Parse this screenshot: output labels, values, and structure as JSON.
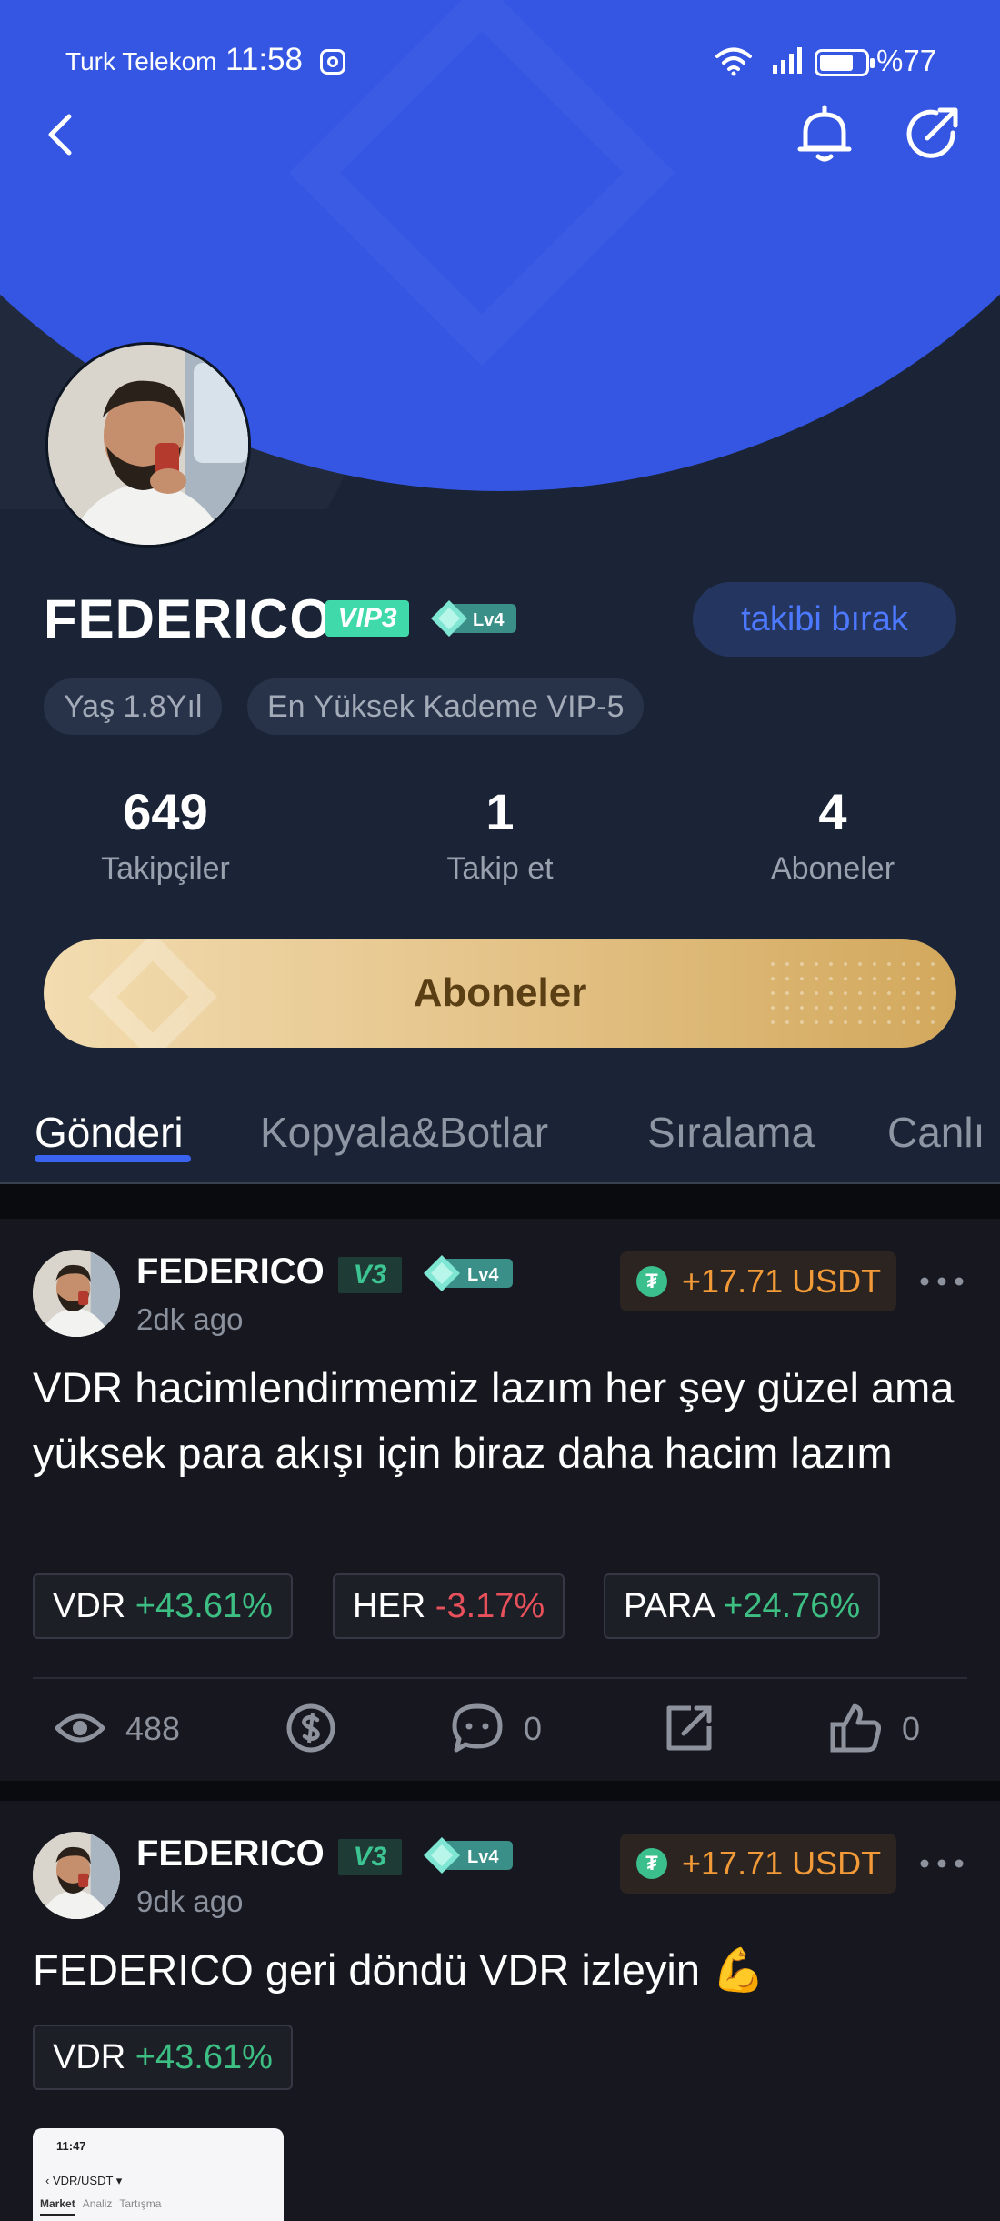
{
  "status_bar": {
    "carrier": "Turk Telekom",
    "time": "11:58",
    "battery": "%77"
  },
  "profile": {
    "name": "FEDERICO",
    "vip_badge": "VIP3",
    "level_badge": "Lv4",
    "unfollow_label": "takibi bırak",
    "tags": [
      "Yaş 1.8Yıl",
      "En Yüksek Kademe VIP-5"
    ],
    "stats": [
      {
        "value": "649",
        "label": "Takipçiler"
      },
      {
        "value": "1",
        "label": "Takip et"
      },
      {
        "value": "4",
        "label": "Aboneler"
      }
    ],
    "subscribe_label": "Aboneler"
  },
  "tabs": [
    {
      "label": "Gönderi",
      "active": true
    },
    {
      "label": "Kopyala&Botlar",
      "active": false
    },
    {
      "label": "Sıralama",
      "active": false
    },
    {
      "label": "Canlı",
      "active": false
    }
  ],
  "posts": [
    {
      "author": "FEDERICO",
      "badge": "V3",
      "level": "Lv4",
      "time": "2dk ago",
      "reward": "+17.71 USDT",
      "text": "VDR hacimlendirmemiz lazım her şey güzel ama yüksek para akışı için biraz daha hacim lazım",
      "coins": [
        {
          "symbol": "VDR",
          "change": "+43.61%",
          "direction": "up"
        },
        {
          "symbol": "HER",
          "change": "-3.17%",
          "direction": "down"
        },
        {
          "symbol": "PARA",
          "change": "+24.76%",
          "direction": "up"
        }
      ],
      "views": "488",
      "comments": "0",
      "likes": "0"
    },
    {
      "author": "FEDERICO",
      "badge": "V3",
      "level": "Lv4",
      "time": "9dk ago",
      "reward": "+17.71 USDT",
      "text": "FEDERICO geri döndü VDR izleyin 💪",
      "coins": [
        {
          "symbol": "VDR",
          "change": "+43.61%",
          "direction": "up"
        }
      ],
      "thumbnail": {
        "time": "11:47",
        "pair": "VDR/USDT",
        "tabs": [
          "Market",
          "Analiz",
          "Tartışma"
        ]
      }
    }
  ],
  "colors": {
    "header_blue": "#3456e3",
    "panel_bg": "#1a2436",
    "feed_bg": "#16171f",
    "accent_blue": "#3a63f0",
    "up_green": "#3dbf83",
    "down_red": "#e8515b",
    "reward_orange": "#f29a37",
    "gold": "#e3c185"
  },
  "icons": {
    "back": "chevron-left-icon",
    "bell": "bell-icon",
    "share": "share-icon",
    "views": "eye-icon",
    "tip": "coin-icon",
    "comment": "comment-icon",
    "repost": "share-out-icon",
    "like": "thumbs-up-icon",
    "more": "more-dots-icon"
  }
}
